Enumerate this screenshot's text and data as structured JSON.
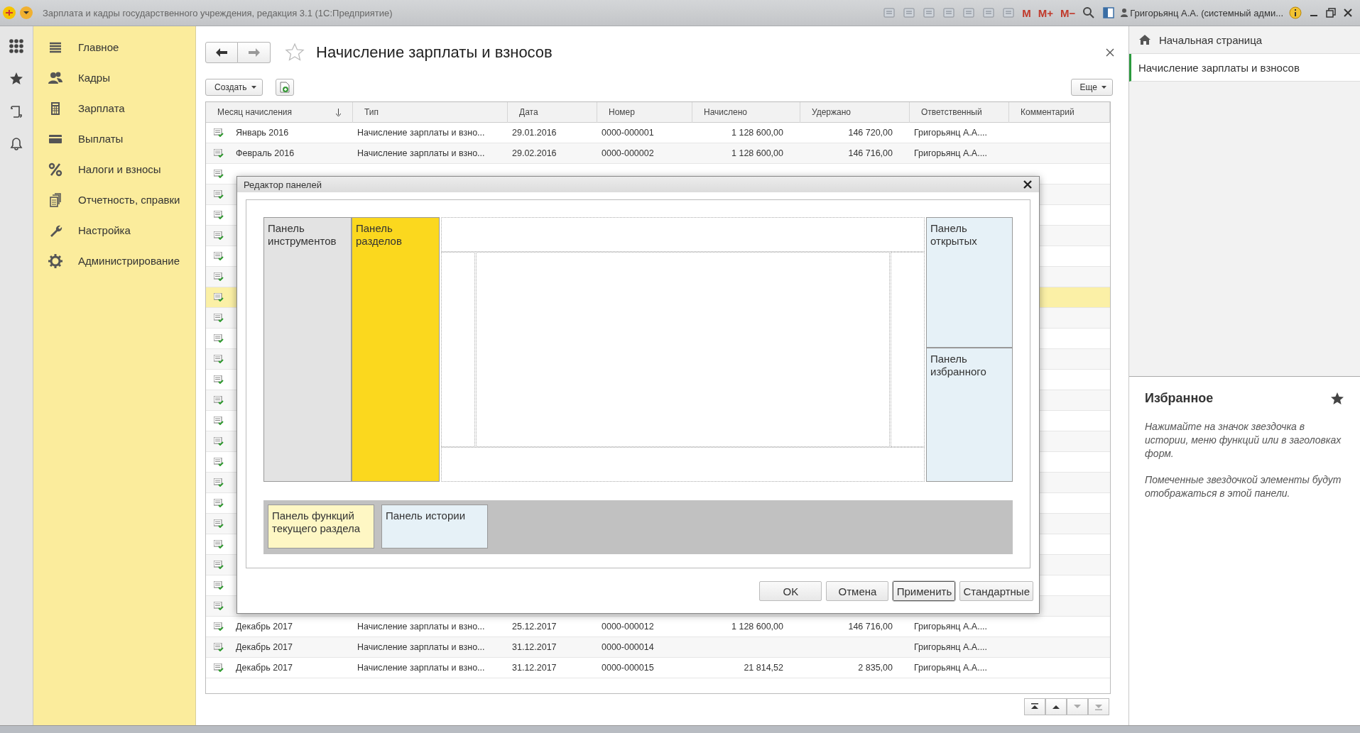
{
  "window": {
    "title": "Зарплата и кадры государственного учреждения, редакция 3.1  (1С:Предприятие)",
    "memory_buttons": [
      "M",
      "M+",
      "M−"
    ],
    "user": "Григорьянц А.А. (системный адми..."
  },
  "sections": [
    {
      "label": "Главное",
      "selected": false
    },
    {
      "label": "Кадры",
      "selected": false
    },
    {
      "label": "Зарплата",
      "selected": false
    },
    {
      "label": "Выплаты",
      "selected": false
    },
    {
      "label": "Налоги и взносы",
      "selected": false
    },
    {
      "label": "Отчетность, справки",
      "selected": false
    },
    {
      "label": "Настройка",
      "selected": false
    },
    {
      "label": "Администрирование",
      "selected": false
    }
  ],
  "form": {
    "title": "Начисление зарплаты и взносов",
    "create_button": "Создать",
    "more_button": "Еще"
  },
  "table": {
    "columns": [
      {
        "label": "Месяц начисления",
        "sorted": true
      },
      {
        "label": "Тип",
        "sorted": false
      },
      {
        "label": "Дата",
        "sorted": false
      },
      {
        "label": "Номер",
        "sorted": false
      },
      {
        "label": "Начислено",
        "sorted": false
      },
      {
        "label": "Удержано",
        "sorted": false
      },
      {
        "label": "Ответственный",
        "sorted": false
      },
      {
        "label": "Комментарий",
        "sorted": false
      }
    ],
    "rows": [
      {
        "selected": false,
        "cells": [
          "Январь 2016",
          "Начисление зарплаты и взно...",
          "29.01.2016",
          "0000-000001",
          "1 128 600,00",
          "146 720,00",
          "Григорьянц А.А...."
        ]
      },
      {
        "selected": false,
        "cells": [
          "Февраль 2016",
          "Начисление зарплаты и взно...",
          "29.02.2016",
          "0000-000002",
          "1 128 600,00",
          "146 716,00",
          "Григорьянц А.А...."
        ]
      },
      {
        "selected": false
      },
      {
        "selected": false
      },
      {
        "selected": false
      },
      {
        "selected": false
      },
      {
        "selected": false
      },
      {
        "selected": false
      },
      {
        "selected": true
      },
      {
        "selected": false
      },
      {
        "selected": false
      },
      {
        "selected": false
      },
      {
        "selected": false
      },
      {
        "selected": false
      },
      {
        "selected": false
      },
      {
        "selected": false
      },
      {
        "selected": false
      },
      {
        "selected": false
      },
      {
        "selected": false
      },
      {
        "selected": false
      },
      {
        "selected": false
      },
      {
        "selected": false
      },
      {
        "selected": false
      },
      {
        "selected": false
      },
      {
        "selected": false,
        "cells": [
          "Декабрь 2017",
          "Начисление зарплаты и взно...",
          "25.12.2017",
          "0000-000012",
          "1 128 600,00",
          "146 716,00",
          "Григорьянц А.А...."
        ]
      },
      {
        "selected": false,
        "cells": [
          "Декабрь 2017",
          "Начисление зарплаты и взно...",
          "31.12.2017",
          "0000-000014",
          "",
          "",
          "Григорьянц А.А...."
        ]
      },
      {
        "selected": false,
        "cells": [
          "Декабрь 2017",
          "Начисление зарплаты и взно...",
          "31.12.2017",
          "0000-000015",
          "21 814,52",
          "2 835,00",
          "Григорьянц А.А...."
        ]
      }
    ]
  },
  "history_panel": {
    "home": "Начальная страница",
    "items": [
      {
        "label": "Начисление зарплаты и взносов",
        "selected": true
      }
    ]
  },
  "favorites_panel": {
    "title": "Избранное",
    "hints": [
      "Нажимайте на значок звездочка в истории, меню функций или в заголовках форм.",
      "Помеченные звездочкой элементы будут отображаться в этой панели."
    ]
  },
  "dialog": {
    "title": "Редактор панелей",
    "panels": [
      {
        "kind": "tools",
        "label": "Панель инструментов"
      },
      {
        "kind": "sections",
        "label": "Панель разделов"
      },
      {
        "kind": "open",
        "label": "Панель открытых"
      },
      {
        "kind": "favorites",
        "label": "Панель избранного"
      },
      {
        "kind": "functions",
        "label": "Панель функций текущего раздела"
      },
      {
        "kind": "history",
        "label": "Панель истории"
      }
    ],
    "buttons": [
      {
        "label": "OK",
        "focused": false
      },
      {
        "label": "Отмена",
        "focused": false
      },
      {
        "label": "Применить",
        "focused": true
      },
      {
        "label": "Стандартные",
        "focused": false
      }
    ]
  }
}
